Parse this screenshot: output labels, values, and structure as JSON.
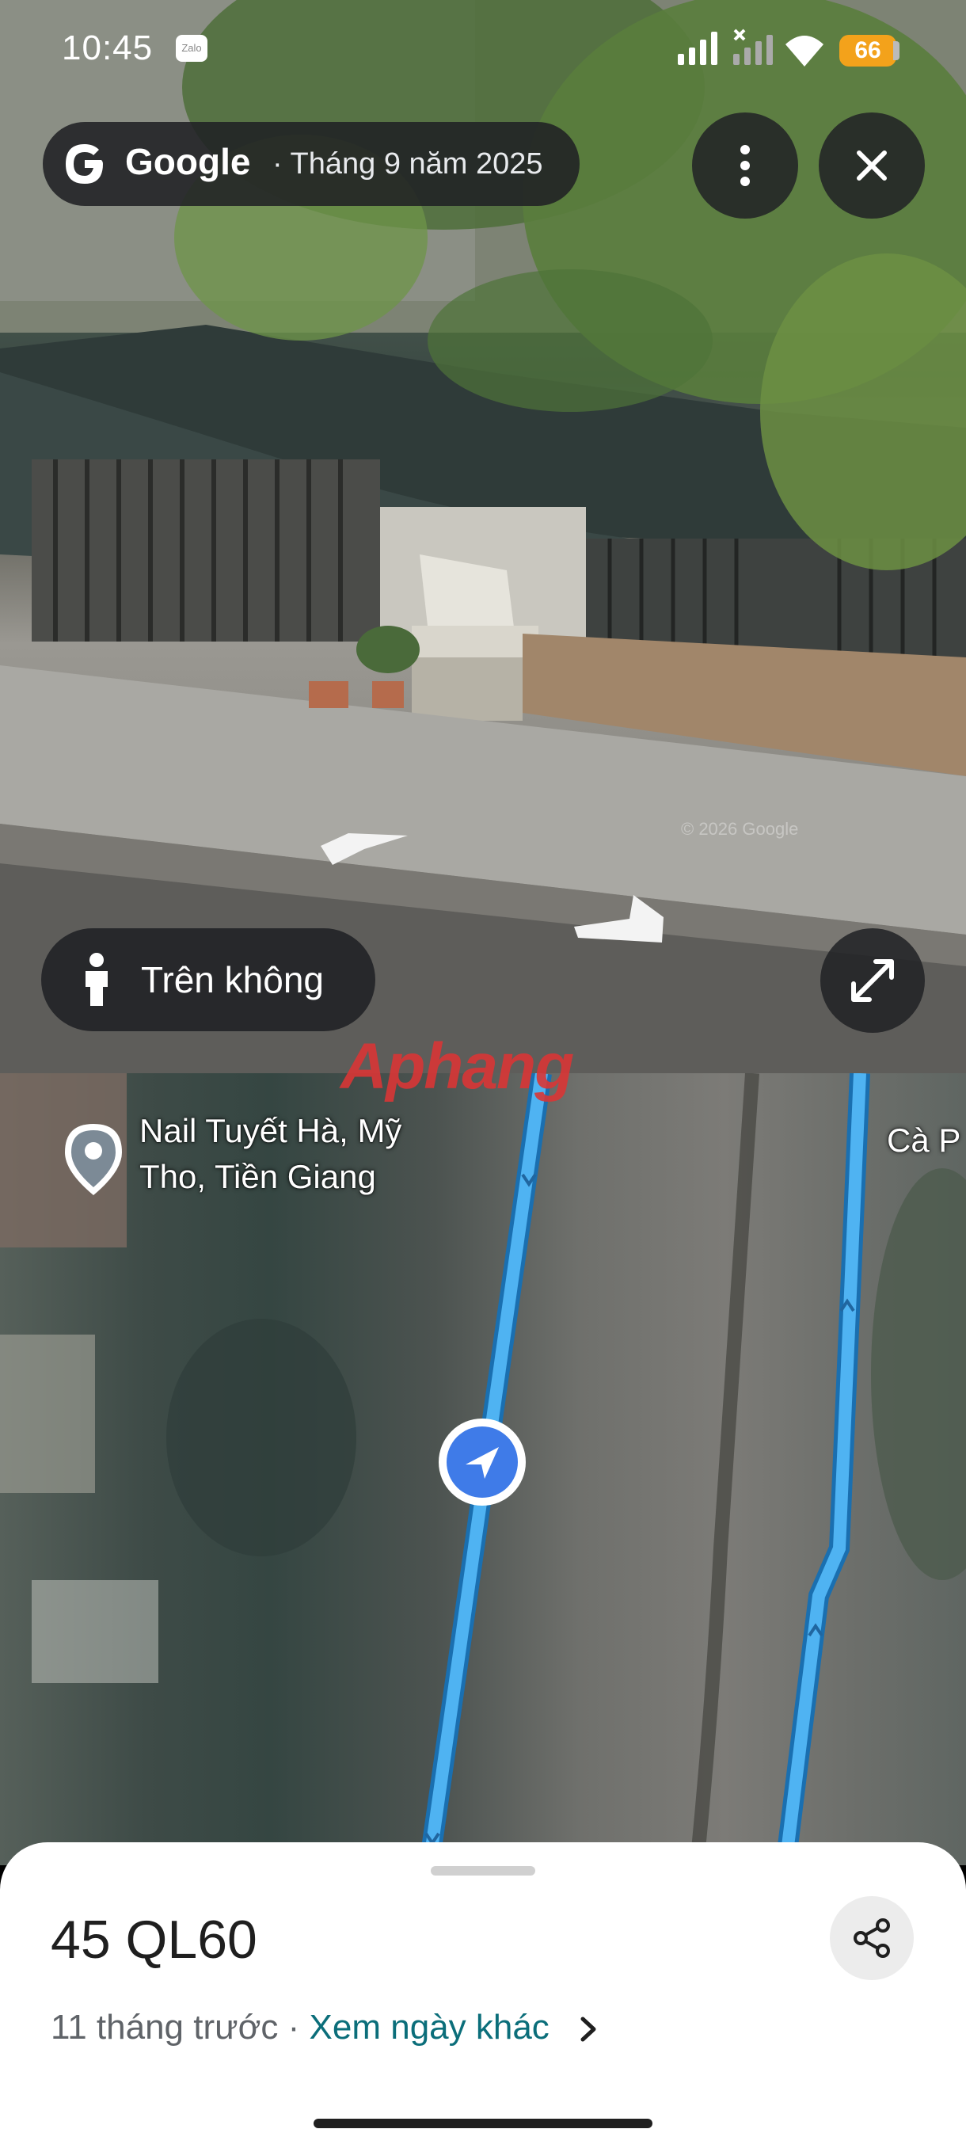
{
  "status_bar": {
    "time": "10:45",
    "notification_icon": "zalo-icon",
    "notification_label": "Zalo",
    "battery": "66"
  },
  "street_view": {
    "source": "Google",
    "date": "· Tháng 9 năm 2025",
    "aerial_button_label": "Trên không",
    "copyright": "© 2026 Google",
    "watermark": "Aphang"
  },
  "map": {
    "place_label": "Nail Tuyết Hà, Mỹ Tho, Tiền Giang",
    "place_label_line1": "Nail Tuyết Hà, Mỹ",
    "place_label_line2": "Tho, Tiền Giang",
    "edge_label": "Cà P"
  },
  "sheet": {
    "title": "45 QL60",
    "age": "11 tháng trước",
    "separator": " · ",
    "other_dates_link": "Xem ngày khác"
  },
  "icons": [
    "google-g-icon",
    "more-vert-icon",
    "close-icon",
    "pegman-icon",
    "expand-icon",
    "place-pin-icon",
    "position-arrow-icon",
    "share-icon",
    "chevron-right-icon"
  ],
  "colors": {
    "route_blue": "#4fb3f2",
    "link_teal": "#0b6e7a",
    "battery_orange": "#f3a21b"
  }
}
